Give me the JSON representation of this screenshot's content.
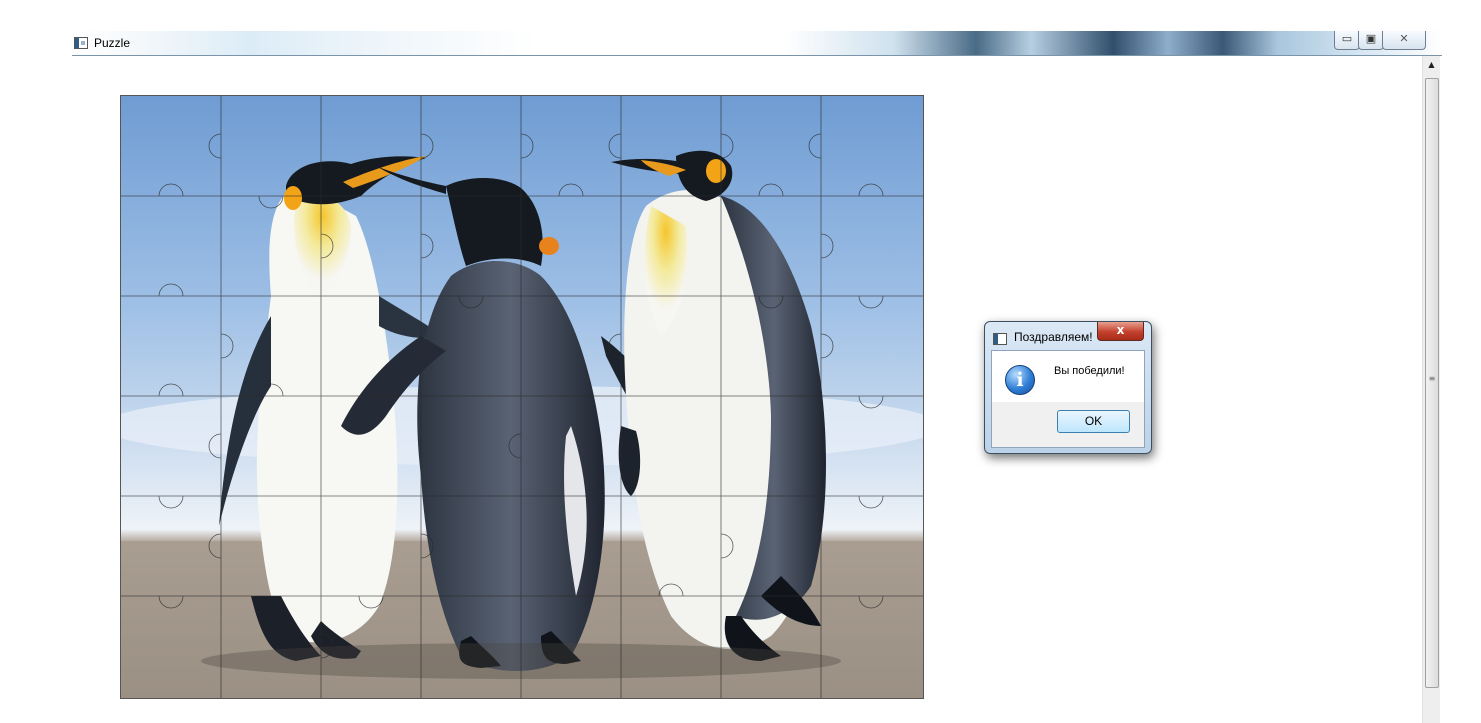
{
  "window": {
    "title": "Puzzle",
    "controls": {
      "minimize": "▭",
      "maximize": "▣",
      "close": "✕"
    }
  },
  "puzzle": {
    "grid": {
      "columns": 8,
      "rows": 6
    },
    "image": "penguins-puzzle"
  },
  "dialog": {
    "title": "Поздравляем!",
    "close": "x",
    "icon": "info-icon",
    "icon_glyph": "i",
    "message": "Вы победили!",
    "ok_label": "OK"
  },
  "scrollbar": {
    "up_arrow": "▲",
    "grip": "≡"
  }
}
